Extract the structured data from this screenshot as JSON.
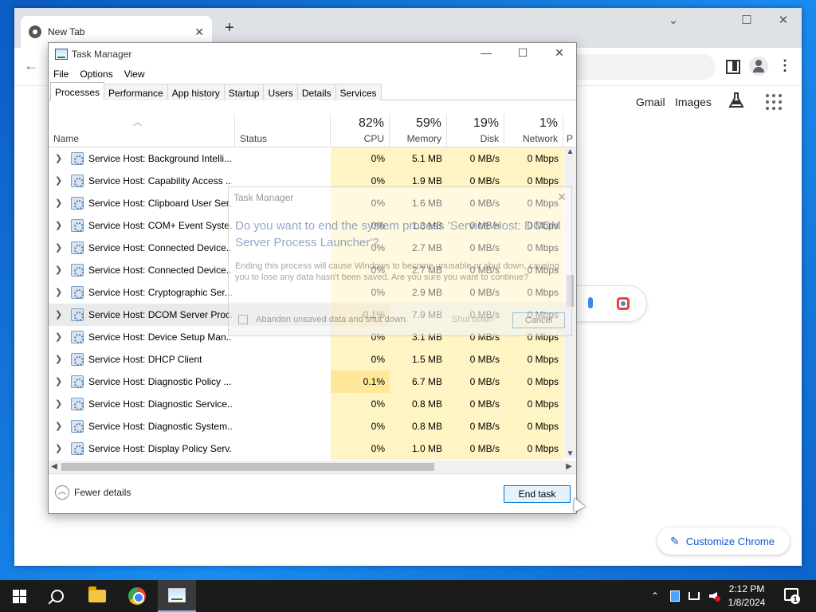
{
  "chrome": {
    "tab_title": "New Tab",
    "tab_close": "✕",
    "new_tab": "+",
    "controls": {
      "minimize": "⌄",
      "restore": "☐",
      "close": "✕"
    },
    "back": "←",
    "menu": "⋮",
    "links": {
      "gmail": "Gmail",
      "images": "Images"
    },
    "customize_label": "Customize Chrome",
    "customize_icon": "✎"
  },
  "taskmgr": {
    "title": "Task Manager",
    "controls": {
      "minimize": "—",
      "maximize": "☐",
      "close": "✕"
    },
    "menu": [
      "File",
      "Options",
      "View"
    ],
    "tabs": [
      "Processes",
      "Performance",
      "App history",
      "Startup",
      "Users",
      "Details",
      "Services"
    ],
    "active_tab": "Processes",
    "columns": {
      "name": "Name",
      "status": "Status",
      "cpu": {
        "pct": "82%",
        "label": "CPU"
      },
      "memory": {
        "pct": "59%",
        "label": "Memory"
      },
      "disk": {
        "pct": "19%",
        "label": "Disk"
      },
      "network": {
        "pct": "1%",
        "label": "Network"
      },
      "extra": "P"
    },
    "processes": [
      {
        "name": "Service Host: Background Intelli...",
        "cpu": "0%",
        "mem": "5.1 MB",
        "disk": "0 MB/s",
        "net": "0 Mbps"
      },
      {
        "name": "Service Host: Capability Access ...",
        "cpu": "0%",
        "mem": "1.9 MB",
        "disk": "0 MB/s",
        "net": "0 Mbps"
      },
      {
        "name": "Service Host: Clipboard User Ser...",
        "cpu": "0%",
        "mem": "1.6 MB",
        "disk": "0 MB/s",
        "net": "0 Mbps"
      },
      {
        "name": "Service Host: COM+ Event Syste...",
        "cpu": "0%",
        "mem": "1.3 MB",
        "disk": "0 MB/s",
        "net": "0 Mbps"
      },
      {
        "name": "Service Host: Connected Device...",
        "cpu": "0%",
        "mem": "2.7 MB",
        "disk": "0 MB/s",
        "net": "0 Mbps"
      },
      {
        "name": "Service Host: Connected Device...",
        "cpu": "0%",
        "mem": "2.7 MB",
        "disk": "0 MB/s",
        "net": "0 Mbps"
      },
      {
        "name": "Service Host: Cryptographic Ser...",
        "cpu": "0%",
        "mem": "2.9 MB",
        "disk": "0 MB/s",
        "net": "0 Mbps"
      },
      {
        "name": "Service Host: DCOM Server Proc...",
        "cpu": "0.1%",
        "mem": "7.9 MB",
        "disk": "0 MB/s",
        "net": "0 Mbps"
      },
      {
        "name": "Service Host: Device Setup Man...",
        "cpu": "0%",
        "mem": "3.1 MB",
        "disk": "0 MB/s",
        "net": "0 Mbps"
      },
      {
        "name": "Service Host: DHCP Client",
        "cpu": "0%",
        "mem": "1.5 MB",
        "disk": "0 MB/s",
        "net": "0 Mbps"
      },
      {
        "name": "Service Host: Diagnostic Policy ...",
        "cpu": "0.1%",
        "mem": "6.7 MB",
        "disk": "0 MB/s",
        "net": "0 Mbps"
      },
      {
        "name": "Service Host: Diagnostic Service...",
        "cpu": "0%",
        "mem": "0.8 MB",
        "disk": "0 MB/s",
        "net": "0 Mbps"
      },
      {
        "name": "Service Host: Diagnostic System...",
        "cpu": "0%",
        "mem": "0.8 MB",
        "disk": "0 MB/s",
        "net": "0 Mbps"
      },
      {
        "name": "Service Host: Display Policy Serv...",
        "cpu": "0%",
        "mem": "1.0 MB",
        "disk": "0 MB/s",
        "net": "0 Mbps"
      }
    ],
    "fewer_details": "Fewer details",
    "end_task": "End task"
  },
  "dialog": {
    "title": "Task Manager",
    "close": "✕",
    "main": "Do you want to end the system process 'Service Host: DCOM Server Process Launcher'?",
    "body": "Ending this process will cause Windows to become unusable or shut down, causing you to lose any data hasn't been saved. Are you sure you want to continue?",
    "checkbox_label": "Abandon unsaved data and shut down.",
    "shutdown_btn": "Shut down",
    "cancel_btn": "Cancel"
  },
  "taskbar": {
    "time": "2:12 PM",
    "date": "1/8/2024",
    "notification_count": "1",
    "tray_chevron": "⌃"
  }
}
